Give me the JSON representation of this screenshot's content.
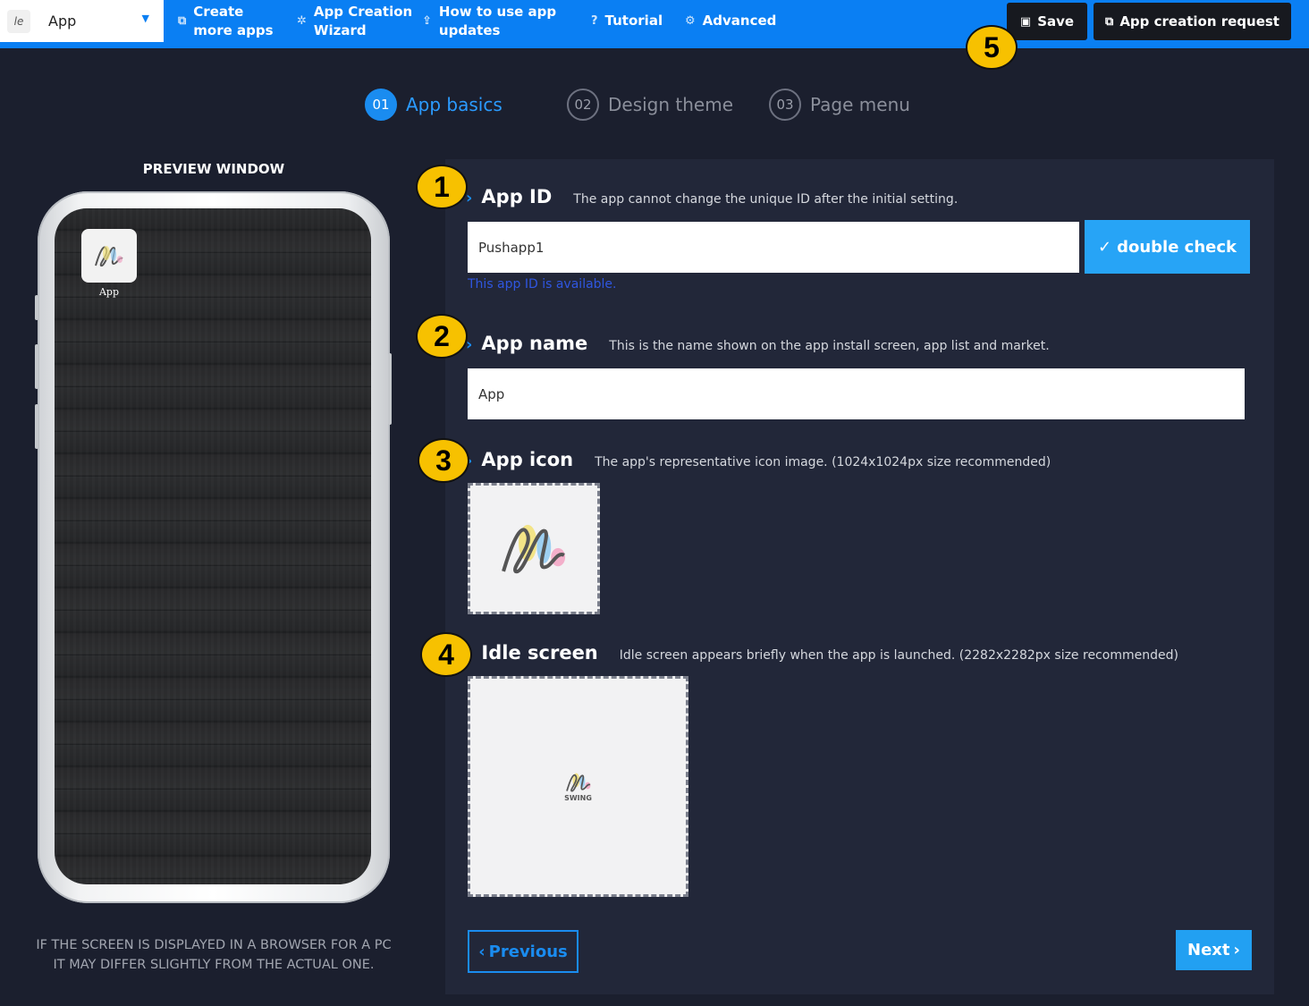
{
  "topbar": {
    "app_select": {
      "label": "App"
    },
    "nav": [
      {
        "line1": "Create",
        "line2": "more apps"
      },
      {
        "line1": "App Creation",
        "line2": "Wizard"
      },
      {
        "line1": "How to use app",
        "line2": "updates"
      },
      {
        "label": "Tutorial"
      },
      {
        "label": "Advanced"
      }
    ],
    "save_label": "Save",
    "request_label": "App creation request"
  },
  "badges": [
    "1",
    "2",
    "3",
    "4",
    "5"
  ],
  "steps": [
    {
      "num": "01",
      "label": "App basics",
      "active": true
    },
    {
      "num": "02",
      "label": "Design theme",
      "active": false
    },
    {
      "num": "03",
      "label": "Page menu",
      "active": false
    }
  ],
  "preview": {
    "title": "PREVIEW WINDOW",
    "app_label": "App",
    "note_line1": "IF THE SCREEN IS DISPLAYED IN A BROWSER FOR A PC",
    "note_line2": "IT MAY DIFFER SLIGHTLY FROM THE ACTUAL ONE."
  },
  "form": {
    "app_id": {
      "title": "App ID",
      "desc": "The app cannot change the unique ID after the initial setting.",
      "value": "Pushapp1",
      "check_label": "double check",
      "status": "This app ID is available."
    },
    "app_name": {
      "title": "App name",
      "desc": "This is the name shown on the app install screen, app list and market.",
      "value": "App"
    },
    "app_icon": {
      "title": "App icon",
      "desc": "The app's representative icon image. (1024x1024px size recommended)"
    },
    "idle_screen": {
      "title": "Idle screen",
      "desc": "Idle screen appears briefly when the app is launched. (2282x2282px size recommended)",
      "logo_text": "SWING"
    },
    "prev_label": "Previous",
    "next_label": "Next"
  }
}
